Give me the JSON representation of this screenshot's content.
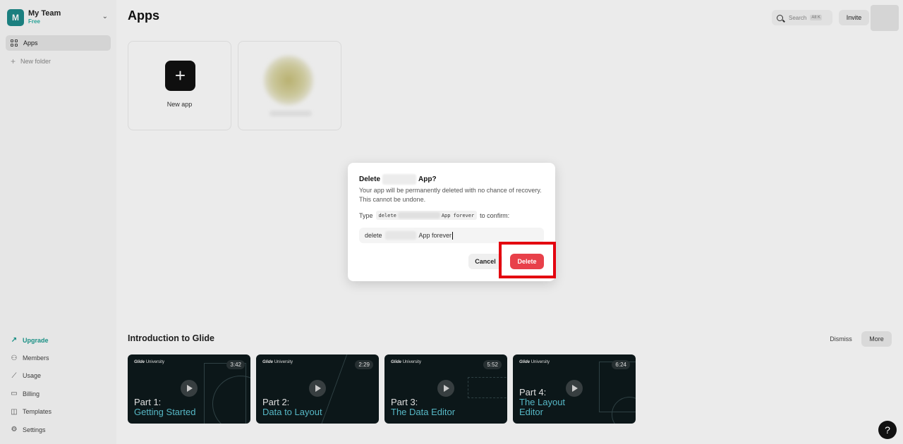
{
  "team": {
    "initial": "M",
    "name": "My Team",
    "plan": "Free"
  },
  "sidebar": {
    "apps_label": "Apps",
    "new_folder_label": "New folder",
    "bottom": [
      {
        "label": "Upgrade",
        "icon": "upgrade-icon"
      },
      {
        "label": "Members",
        "icon": "members-icon"
      },
      {
        "label": "Usage",
        "icon": "usage-icon"
      },
      {
        "label": "Billing",
        "icon": "billing-icon"
      },
      {
        "label": "Templates",
        "icon": "templates-icon"
      },
      {
        "label": "Settings",
        "icon": "settings-icon"
      }
    ]
  },
  "header": {
    "title": "Apps",
    "search_placeholder": "Search",
    "search_shortcut": "Alt K",
    "invite_label": "Invite"
  },
  "apps": {
    "new_app_label": "New app"
  },
  "intro": {
    "title": "Introduction to Glide",
    "dismiss_label": "Dismiss",
    "more_label": "More",
    "videos": [
      {
        "brand": "Glide",
        "brand_suffix": "University",
        "duration": "3:42",
        "line1": "Part 1:",
        "line2": "Getting Started",
        "line3": ""
      },
      {
        "brand": "Glide",
        "brand_suffix": "University",
        "duration": "2:29",
        "line1": "Part 2:",
        "line2": "Data to Layout",
        "line3": ""
      },
      {
        "brand": "Glide",
        "brand_suffix": "University",
        "duration": "5:52",
        "line1": "Part 3:",
        "line2": "The Data Editor",
        "line3": ""
      },
      {
        "brand": "Glide",
        "brand_suffix": "University",
        "duration": "6:24",
        "line1": "Part 4:",
        "line2": "The Layout",
        "line3": "Editor"
      }
    ]
  },
  "dialog": {
    "title_prefix": "Delete",
    "title_suffix": "App?",
    "description": "Your app will be permanently deleted with no chance of recovery. This cannot be undone.",
    "type_prefix": "Type",
    "code_prefix": "delete",
    "code_suffix": "App forever",
    "type_suffix": "to confirm:",
    "input_prefix": "delete",
    "input_suffix": "App forever",
    "cancel_label": "Cancel",
    "delete_label": "Delete",
    "delete_color": "#e8404a"
  },
  "help_label": "?"
}
